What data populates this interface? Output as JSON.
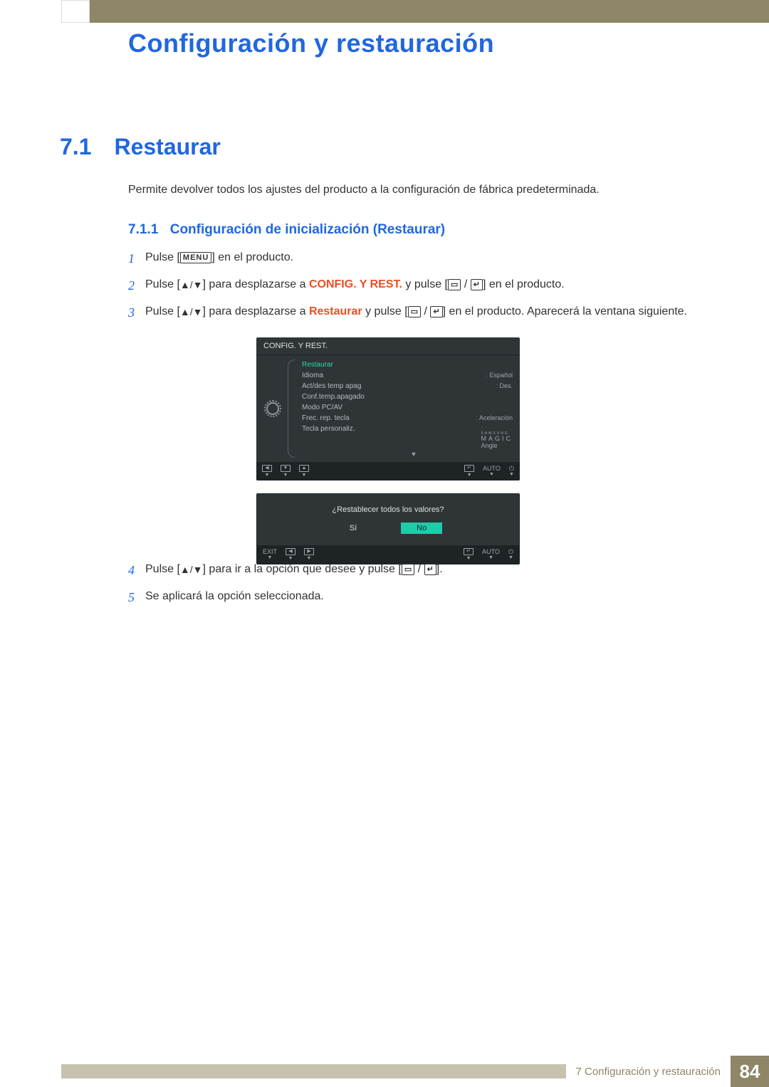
{
  "chapter": {
    "title": "Configuración y restauración"
  },
  "section": {
    "number": "7.1",
    "title": "Restaurar",
    "description": "Permite devolver todos los ajustes del producto a la configuración de fábrica predeterminada."
  },
  "subsection": {
    "number": "7.1.1",
    "title": "Configuración de inicialización (Restaurar)"
  },
  "steps": {
    "s1": {
      "num": "1",
      "prefix": "Pulse [",
      "menu": "MENU",
      "suffix": "] en el producto."
    },
    "s2": {
      "num": "2",
      "prefix": "Pulse [",
      "mid1": "] para desplazarse a ",
      "highlight": "CONFIG. Y REST.",
      "mid2": " y pulse [",
      "suffix": "] en el producto."
    },
    "s3": {
      "num": "3",
      "prefix": "Pulse [",
      "mid1": "] para desplazarse a ",
      "highlight": "Restaurar",
      "mid2": " y pulse [",
      "suffix": "] en el producto. Aparecerá la ventana siguiente."
    },
    "s4": {
      "num": "4",
      "prefix": "Pulse [",
      "mid1": "] para ir a la opción que desee y pulse [",
      "suffix": "]."
    },
    "s5": {
      "num": "5",
      "text": "Se aplicará la opción seleccionada."
    }
  },
  "osd": {
    "title": "CONFIG. Y REST.",
    "items": [
      {
        "label": "Restaurar",
        "value": "",
        "selected": true
      },
      {
        "label": "Idioma",
        "value": "Español"
      },
      {
        "label": "Act/des temp apag",
        "value": "Des."
      },
      {
        "label": "Conf.temp.apagado",
        "value": ""
      },
      {
        "label": "Modo PC/AV",
        "value": ""
      },
      {
        "label": "Frec. rep. tecla",
        "value": "Aceleración"
      },
      {
        "label": "Tecla personaliz.",
        "value_special": "magic_angle"
      }
    ],
    "magic_top": "SAMSUNG",
    "magic_bot": "MAGIC",
    "magic_suffix": " Angle",
    "footer": {
      "auto": "AUTO"
    }
  },
  "osd2": {
    "question": "¿Restablecer todos los valores?",
    "yes": "Sí",
    "no": "No",
    "footer": {
      "exit": "EXIT",
      "auto": "AUTO"
    }
  },
  "footer": {
    "chapter_ref": "7 Configuración y restauración",
    "page": "84"
  }
}
